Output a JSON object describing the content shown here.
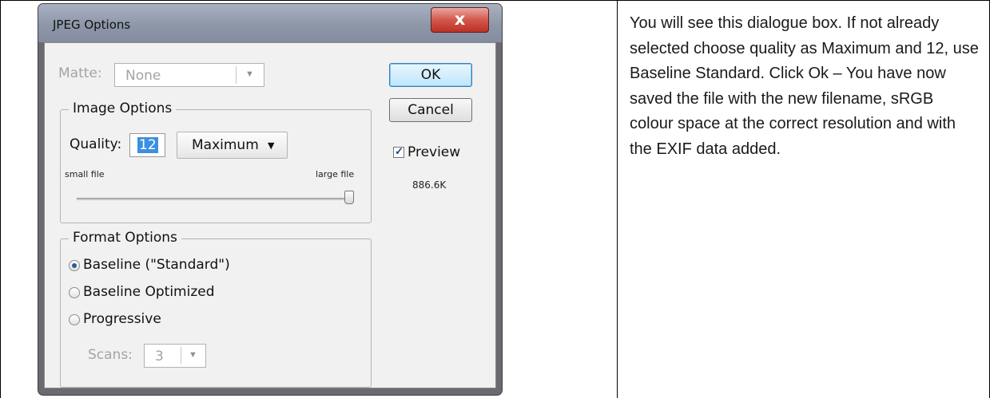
{
  "dialog": {
    "title": "JPEG Options",
    "close_label": "x",
    "matte": {
      "label": "Matte:",
      "value": "None"
    },
    "buttons": {
      "ok": "OK",
      "cancel": "Cancel"
    },
    "preview": {
      "label": "Preview",
      "checked": true
    },
    "file_size": "886.6K",
    "image_options": {
      "title": "Image Options",
      "quality_label": "Quality:",
      "quality_value": "12",
      "quality_preset": "Maximum",
      "slider_min_label": "small file",
      "slider_max_label": "large file",
      "slider_level": 1.0
    },
    "format_options": {
      "title": "Format Options",
      "options": [
        "Baseline (\"Standard\")",
        "Baseline Optimized",
        "Progressive"
      ],
      "selected": 0,
      "scans_label": "Scans:",
      "scans_value": "3"
    }
  },
  "instructions": {
    "text": "You will see this dialogue box.  If not already selected choose quality as Maximum and 12, use Baseline Standard.  Click Ok – You have now saved the file with the new filename, sRGB colour space at the correct resolution and with the EXIF data added."
  }
}
